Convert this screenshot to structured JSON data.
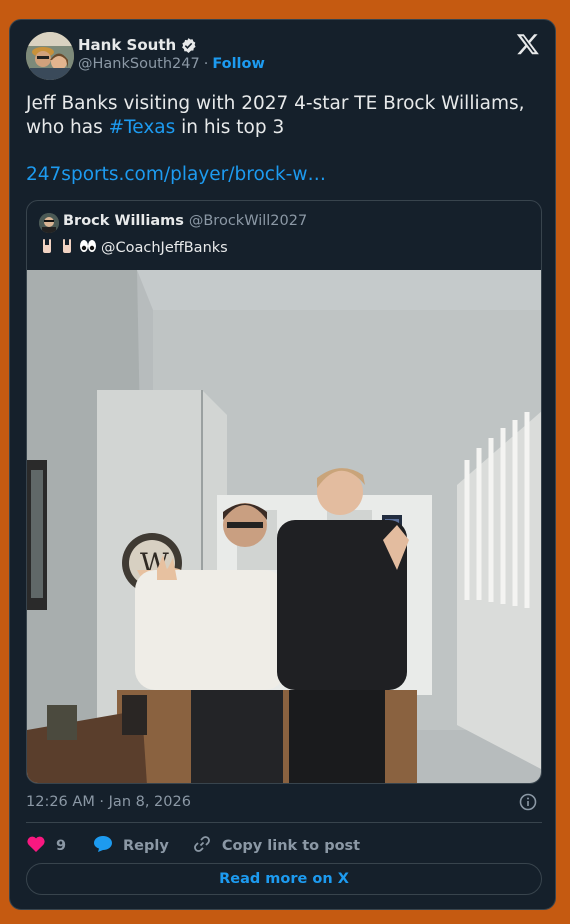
{
  "author": {
    "display_name": "Hank South",
    "handle": "@HankSouth247",
    "separator": "·",
    "follow_label": "Follow"
  },
  "tweet": {
    "text_before": "Jeff Banks visiting with 2027 4-star TE Brock Williams, who has ",
    "hashtag": "#Texas",
    "text_after": " in his top 3",
    "link": "247sports.com/player/brock-w…"
  },
  "quote": {
    "display_name": "Brock Williams",
    "handle": "@BrockWill2027",
    "emojis": [
      "horns-emoji",
      "horns-emoji",
      "eyes-emoji"
    ],
    "mention": "@CoachJeffBanks"
  },
  "meta": {
    "timestamp": "12:26 AM · Jan 8, 2026"
  },
  "actions": {
    "like_count": "9",
    "reply_label": "Reply",
    "copy_label": "Copy link to post"
  },
  "read_more_label": "Read more on X",
  "colors": {
    "background": "#c55a11",
    "card": "#15202b",
    "accent": "#1d9bf0",
    "like": "#f91880"
  }
}
